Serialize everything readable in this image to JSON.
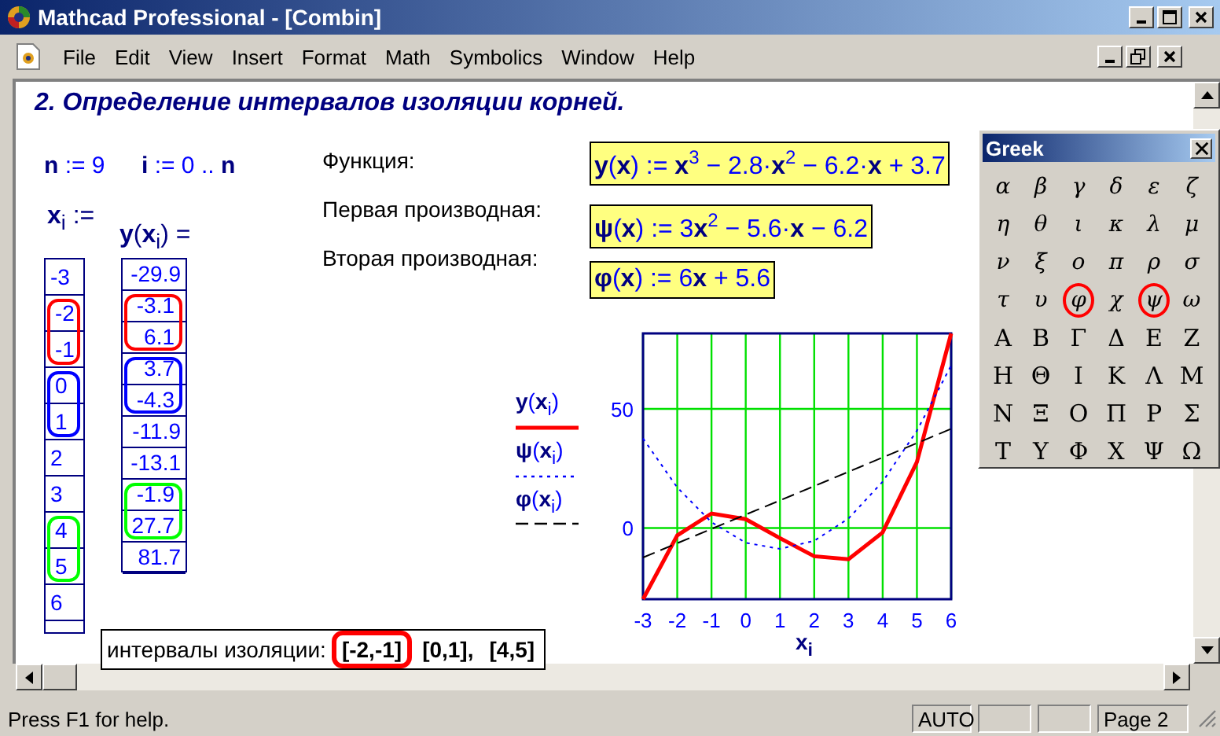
{
  "window": {
    "title": "Mathcad Professional - [Combin]"
  },
  "menu": [
    "File",
    "Edit",
    "View",
    "Insert",
    "Format",
    "Math",
    "Symbolics",
    "Window",
    "Help"
  ],
  "worksheet": {
    "heading": "2. Определение интервалов изоляции корней.",
    "definitions": [
      "**n** := 9",
      "**i** := 0 .. **n**"
    ],
    "x_label": "**x**$_{i}$ :=",
    "y_label": "**y**(**x**$_{i}$) =",
    "x_table": [
      {
        "kind": "cell",
        "value": "-3"
      },
      {
        "kind": "ring",
        "color": "#ff0000",
        "values": [
          "-2",
          "-1"
        ]
      },
      {
        "kind": "ring",
        "color": "#0000ff",
        "values": [
          "0",
          "1"
        ]
      },
      {
        "kind": "cell",
        "value": "2"
      },
      {
        "kind": "cell",
        "value": "3"
      },
      {
        "kind": "ring",
        "color": "#00ff00",
        "values": [
          "4",
          "5"
        ]
      },
      {
        "kind": "cell",
        "value": "6"
      }
    ],
    "y_table": [
      {
        "kind": "cell",
        "value": "-29.9"
      },
      {
        "kind": "ring",
        "color": "#ff0000",
        "values": [
          "-3.1",
          "6.1"
        ]
      },
      {
        "kind": "ring",
        "color": "#0000ff",
        "values": [
          "3.7",
          "-4.3"
        ]
      },
      {
        "kind": "cell",
        "value": "-11.9"
      },
      {
        "kind": "cell",
        "value": "-13.1"
      },
      {
        "kind": "ring",
        "color": "#00ff00",
        "values": [
          "-1.9",
          "27.7"
        ]
      },
      {
        "kind": "cell",
        "value": "81.7"
      }
    ],
    "equations": [
      {
        "label": "Функция:",
        "formula": "**y**(**x**) := **x**$^{3}$ − 2.8·**x**$^{2}$ − 6.2·**x** + 3.7"
      },
      {
        "label": "Первая производная:",
        "formula": "**ψ**(**x**) := 3**x**$^{2}$ − 5.6·**x** − 6.2"
      },
      {
        "label": "Вторая производная:",
        "formula": "**φ**(**x**) := 6**x** + 5.6"
      }
    ],
    "chart_data": {
      "type": "line",
      "grid": true,
      "xlabel": "x$_{i}$",
      "x": [
        -3,
        -2,
        -1,
        0,
        1,
        2,
        3,
        4,
        5,
        6
      ],
      "xlim": [
        -3,
        6
      ],
      "ylim": [
        -29.9,
        81.7
      ],
      "xticks": [
        -3,
        -2,
        -1,
        0,
        1,
        2,
        3,
        4,
        5,
        6
      ],
      "yticks": [
        0,
        50
      ],
      "series": [
        {
          "name": "**y**(**x**$_{i}$)",
          "color": "#ff0000",
          "line_style": "solid",
          "values": [
            -29.9,
            -3.1,
            6.1,
            3.7,
            -4.3,
            -11.9,
            -13.1,
            -1.9,
            27.7,
            81.7
          ]
        },
        {
          "name": "**ψ**(**x**$_{i}$)",
          "color": "#0000ff",
          "line_style": "dotted",
          "values": [
            37.6,
            17,
            2.4,
            -6.2,
            -8.8,
            -5.4,
            4,
            19.4,
            40.8,
            68.2
          ]
        },
        {
          "name": "**φ**(**x**$_{i}$)",
          "color": "#000000",
          "line_style": "dashed",
          "values": [
            -12.4,
            -6.4,
            -0.4,
            5.6,
            11.6,
            17.6,
            23.6,
            29.6,
            35.6,
            41.6
          ]
        }
      ]
    },
    "result": {
      "label": "интервалы изоляции:",
      "intervals": [
        {
          "text": "[-2,-1]",
          "circled": true
        },
        {
          "text": "[0,1],",
          "circled": false
        },
        {
          "text": "[4,5]",
          "circled": false
        }
      ]
    }
  },
  "greek_palette": {
    "title": "Greek",
    "symbols": [
      {
        "s": "α",
        "circled": false
      },
      {
        "s": "β",
        "circled": false
      },
      {
        "s": "γ",
        "circled": false
      },
      {
        "s": "δ",
        "circled": false
      },
      {
        "s": "ε",
        "circled": false
      },
      {
        "s": "ζ",
        "circled": false
      },
      {
        "s": "η",
        "circled": false
      },
      {
        "s": "θ",
        "circled": false
      },
      {
        "s": "ι",
        "circled": false
      },
      {
        "s": "κ",
        "circled": false
      },
      {
        "s": "λ",
        "circled": false
      },
      {
        "s": "μ",
        "circled": false
      },
      {
        "s": "ν",
        "circled": false
      },
      {
        "s": "ξ",
        "circled": false
      },
      {
        "s": "ο",
        "circled": false
      },
      {
        "s": "π",
        "circled": false
      },
      {
        "s": "ρ",
        "circled": false
      },
      {
        "s": "σ",
        "circled": false
      },
      {
        "s": "τ",
        "circled": false
      },
      {
        "s": "υ",
        "circled": false
      },
      {
        "s": "φ",
        "circled": true
      },
      {
        "s": "χ",
        "circled": false
      },
      {
        "s": "ψ",
        "circled": true
      },
      {
        "s": "ω",
        "circled": false
      },
      {
        "s": "Α",
        "circled": false
      },
      {
        "s": "Β",
        "circled": false
      },
      {
        "s": "Γ",
        "circled": false
      },
      {
        "s": "Δ",
        "circled": false
      },
      {
        "s": "Ε",
        "circled": false
      },
      {
        "s": "Ζ",
        "circled": false
      },
      {
        "s": "Η",
        "circled": false
      },
      {
        "s": "Θ",
        "circled": false
      },
      {
        "s": "Ι",
        "circled": false
      },
      {
        "s": "Κ",
        "circled": false
      },
      {
        "s": "Λ",
        "circled": false
      },
      {
        "s": "Μ",
        "circled": false
      },
      {
        "s": "Ν",
        "circled": false
      },
      {
        "s": "Ξ",
        "circled": false
      },
      {
        "s": "Ο",
        "circled": false
      },
      {
        "s": "Π",
        "circled": false
      },
      {
        "s": "Ρ",
        "circled": false
      },
      {
        "s": "Σ",
        "circled": false
      },
      {
        "s": "Τ",
        "circled": false
      },
      {
        "s": "Υ",
        "circled": false
      },
      {
        "s": "Φ",
        "circled": false
      },
      {
        "s": "Χ",
        "circled": false
      },
      {
        "s": "Ψ",
        "circled": false
      },
      {
        "s": "Ω",
        "circled": false
      }
    ]
  },
  "status_bar": {
    "message": "Press F1 for help.",
    "mode": "AUTO",
    "page": "Page 2"
  }
}
